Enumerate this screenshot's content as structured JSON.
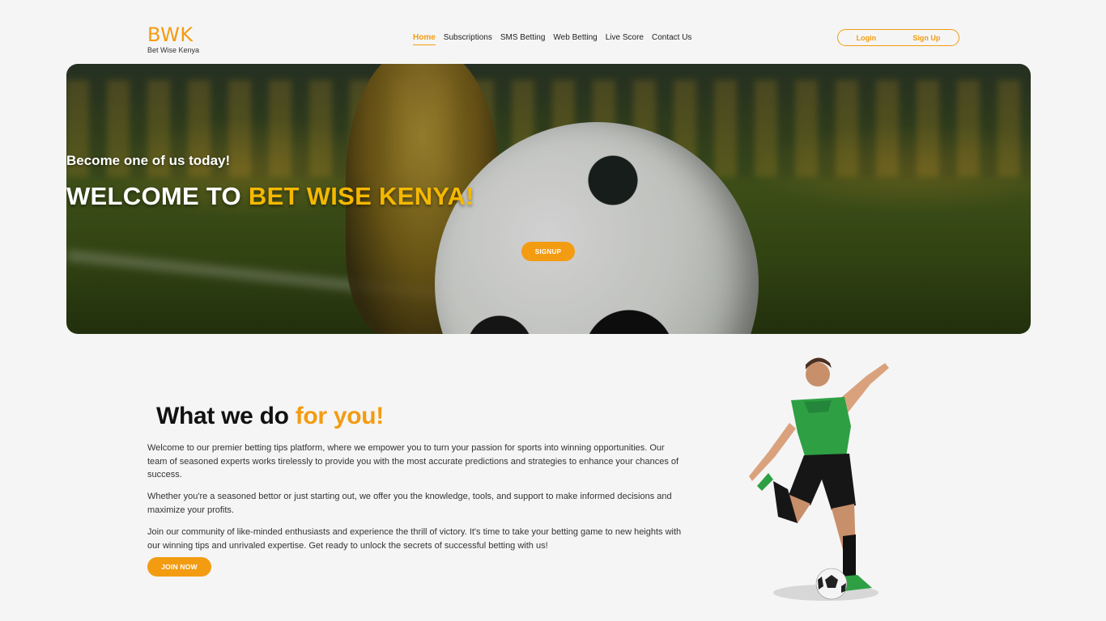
{
  "header": {
    "logo": "BWK",
    "logo_sub": "Bet Wise Kenya",
    "nav": [
      {
        "label": "Home",
        "active": true
      },
      {
        "label": "Subscriptions",
        "active": false
      },
      {
        "label": "SMS Betting",
        "active": false
      },
      {
        "label": "Web Betting",
        "active": false
      },
      {
        "label": "Live Score",
        "active": false
      },
      {
        "label": "Contact Us",
        "active": false
      }
    ],
    "login_label": "Login",
    "signup_label": "Sign Up"
  },
  "hero": {
    "tagline": "Become one of us today!",
    "title_white": "WELCOME TO ",
    "title_yellow": "BET WISE KENYA!",
    "button": "SIGNUP"
  },
  "section": {
    "title_black": "What we do ",
    "title_orange": "for you!",
    "paragraphs": [
      "Welcome to our premier betting tips platform, where we empower you to turn your passion for sports into winning opportunities. Our team of seasoned experts works tirelessly to provide you with the most accurate predictions and strategies to enhance your chances of success.",
      "Whether you're a seasoned bettor or just starting out, we offer you the knowledge, tools, and support to make informed decisions and maximize your profits.",
      "Join our community of like-minded enthusiasts and experience the thrill of victory. It's time to take your betting game to new heights with our winning tips and unrivaled expertise. Get ready to unlock the secrets of successful betting with us!"
    ],
    "button": "JOIN NOW"
  },
  "colors": {
    "accent": "#f39c12",
    "hero_yellow": "#f5b800",
    "background": "#f5f5f5"
  }
}
